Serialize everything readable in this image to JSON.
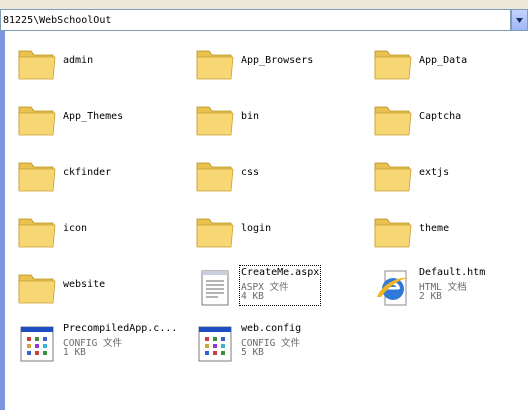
{
  "address": {
    "path": "81225\\WebSchoolOut"
  },
  "folders": [
    {
      "name": "admin"
    },
    {
      "name": "App_Browsers"
    },
    {
      "name": "App_Data"
    },
    {
      "name": "App_Themes"
    },
    {
      "name": "bin"
    },
    {
      "name": "Captcha"
    },
    {
      "name": "ckfinder"
    },
    {
      "name": "css"
    },
    {
      "name": "extjs"
    },
    {
      "name": "icon"
    },
    {
      "name": "login"
    },
    {
      "name": "theme"
    },
    {
      "name": "website"
    }
  ],
  "files": [
    {
      "name": "CreateMe.aspx",
      "type": "ASPX 文件",
      "size": "4 KB",
      "icon": "document-text-icon",
      "selected": true
    },
    {
      "name": "Default.htm",
      "type": "HTML 文档",
      "size": "2 KB",
      "icon": "internet-explorer-icon"
    },
    {
      "name": "PrecompiledApp.c...",
      "type": "CONFIG 文件",
      "size": "1 KB",
      "icon": "config-file-icon"
    },
    {
      "name": "web.config",
      "type": "CONFIG 文件",
      "size": "5 KB",
      "icon": "config-file-icon"
    }
  ],
  "colors": {
    "folder_body": "#f7d773",
    "folder_tab": "#e9c250",
    "selection_accent": "#316ac5"
  }
}
